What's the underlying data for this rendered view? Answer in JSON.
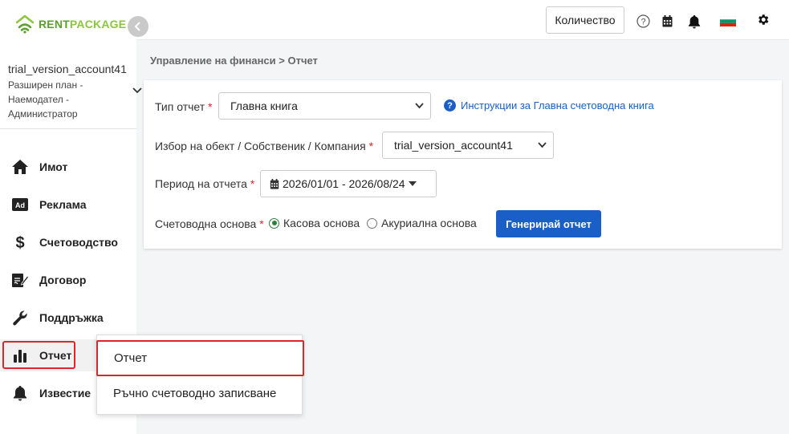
{
  "brand": {
    "rent": "RENT",
    "package": "PACKAGE"
  },
  "account": {
    "name": "trial_version_account41",
    "plan_lines": [
      "Разширен план -",
      "Наемодател -",
      "Администратор"
    ]
  },
  "sidebar": {
    "items": [
      {
        "label": "Имот",
        "icon": "home-icon"
      },
      {
        "label": "Реклама",
        "icon": "ad-icon"
      },
      {
        "label": "Счетоводство",
        "icon": "dollar-icon"
      },
      {
        "label": "Договор",
        "icon": "contract-icon"
      },
      {
        "label": "Поддръжка",
        "icon": "wrench-icon"
      },
      {
        "label": "Отчет",
        "icon": "bar-chart-icon",
        "active": true
      },
      {
        "label": "Известие",
        "icon": "bell-icon"
      }
    ]
  },
  "topbar": {
    "quantity_label": "Количество",
    "icons": [
      "help-icon",
      "calendar-icon",
      "bell-icon",
      "bulgarian-flag-icon",
      "gear-icon"
    ]
  },
  "breadcrumb": "Управление на финанси > Отчет",
  "form": {
    "report_type": {
      "label": "Тип отчет",
      "required": "*",
      "value": "Главна книга"
    },
    "help_link": "Инструкции за Главна счетоводна книга",
    "object": {
      "label": "Избор на обект / Собственик / Компания",
      "required": "*",
      "value": "trial_version_account41"
    },
    "period": {
      "label": "Период на отчета",
      "required": "*",
      "value": "2026/01/01 - 2026/08/24"
    },
    "basis": {
      "label": "Счетоводна основа",
      "required": "*",
      "options": [
        {
          "label": "Касова основа",
          "checked": true
        },
        {
          "label": "Акуриална основа",
          "checked": false
        }
      ]
    },
    "generate_label": "Генерирай отчет"
  },
  "submenu": {
    "items": [
      {
        "label": "Отчет",
        "active": true
      },
      {
        "label": "Ръчно счетоводно записване",
        "active": false
      }
    ]
  },
  "colors": {
    "primary": "#1a5fc8",
    "brand_green": "#5aa02c",
    "highlight_red": "#d9272e"
  }
}
